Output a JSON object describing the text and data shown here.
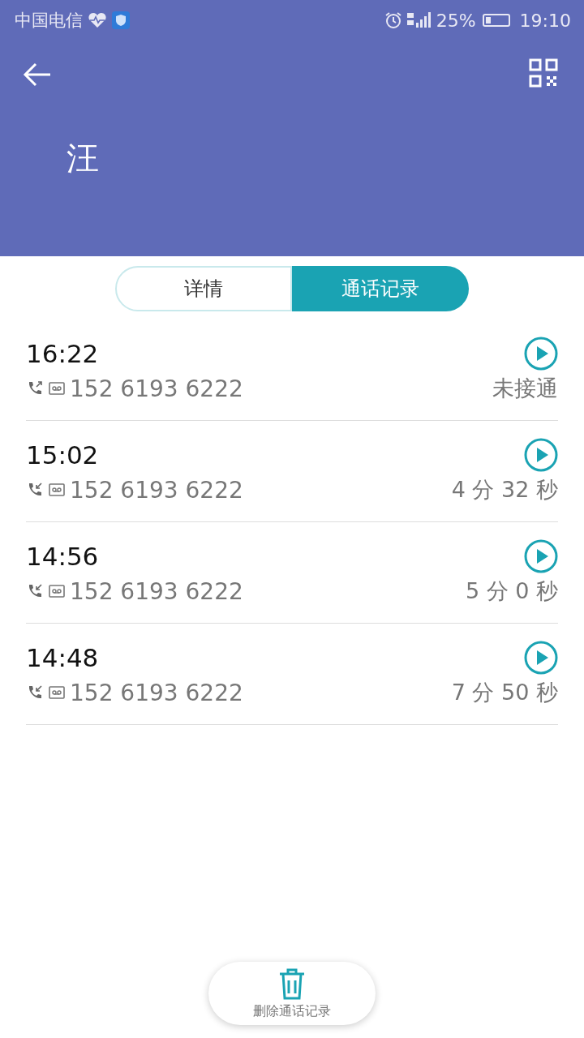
{
  "status_bar": {
    "carrier": "中国电信",
    "battery": "25%",
    "time": "19:10"
  },
  "header": {
    "name": "汪"
  },
  "tabs": [
    {
      "label": "详情",
      "selected": false
    },
    {
      "label": "通话记录",
      "selected": true
    }
  ],
  "calls": [
    {
      "time": "16:22",
      "kind": "outgoing",
      "number": "152 6193 6222",
      "result": "未接通"
    },
    {
      "time": "15:02",
      "kind": "incoming",
      "number": "152 6193 6222",
      "result": "4 分 32 秒"
    },
    {
      "time": "14:56",
      "kind": "incoming",
      "number": "152 6193 6222",
      "result": "5 分 0 秒"
    },
    {
      "time": "14:48",
      "kind": "incoming",
      "number": "152 6193 6222",
      "result": "7 分 50 秒"
    }
  ],
  "delete_button": {
    "label": "删除通话记录"
  }
}
